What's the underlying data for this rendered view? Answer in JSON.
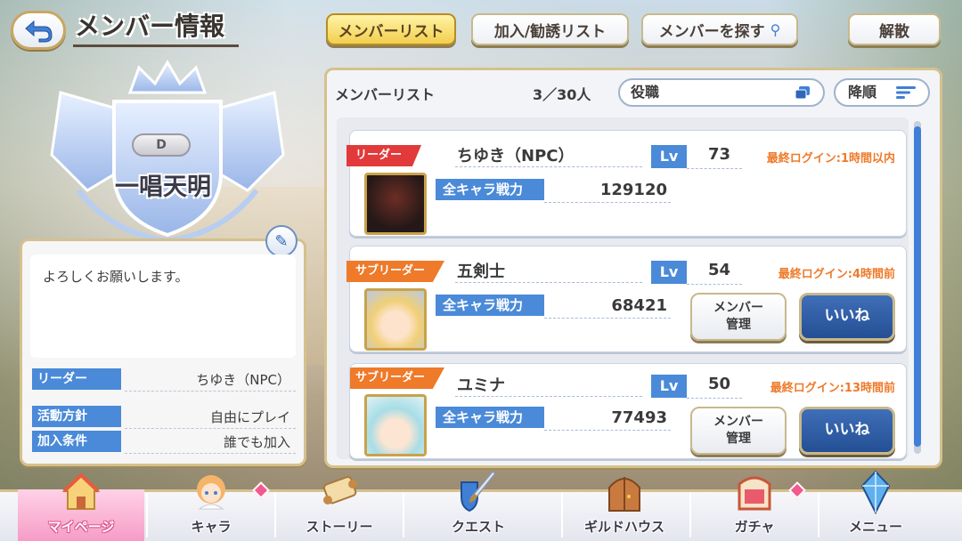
{
  "header": {
    "title": "メンバー情報",
    "tabs": [
      {
        "label": "メンバーリスト",
        "active": true
      },
      {
        "label": "加入/勧誘リスト",
        "active": false
      },
      {
        "label": "メンバーを探す",
        "active": false,
        "icon": "search-icon"
      },
      {
        "label": "解散",
        "active": false
      }
    ]
  },
  "guild": {
    "name": "一唱天明",
    "rank": "D",
    "description": "よろしくお願いします。",
    "info": [
      {
        "key": "リーダー",
        "value": "ちゆき（NPC）"
      },
      {
        "key": "活動方針",
        "value": "自由にプレイ"
      },
      {
        "key": "加入条件",
        "value": "誰でも加入"
      }
    ]
  },
  "member_list": {
    "title": "メンバーリスト",
    "count": "3／30人",
    "sort_key": "役職",
    "sort_order": "降順",
    "power_label": "全キャラ戦力",
    "lv_label": "Lv",
    "members": [
      {
        "role": "リーダー",
        "name": "ちゆき（NPC）",
        "level": "73",
        "power": "129120",
        "last_login": "最終ログイン:1時間以内",
        "manage_label": "",
        "like_label": ""
      },
      {
        "role": "サブリーダー",
        "name": "五剣士",
        "level": "54",
        "power": "68421",
        "last_login": "最終ログイン:4時間前",
        "manage_label": "メンバー\n管理",
        "like_label": "いいね"
      },
      {
        "role": "サブリーダー",
        "name": "ユミナ",
        "level": "50",
        "power": "77493",
        "last_login": "最終ログイン:13時間前",
        "manage_label": "メンバー\n管理",
        "like_label": "いいね"
      }
    ]
  },
  "nav": [
    {
      "label": "マイページ",
      "icon": "home-icon",
      "active": true
    },
    {
      "label": "キャラ",
      "icon": "character-icon",
      "active": false,
      "badge": true
    },
    {
      "label": "ストーリー",
      "icon": "scroll-icon",
      "active": false
    },
    {
      "label": "クエスト",
      "icon": "sword-shield-icon",
      "active": false
    },
    {
      "label": "ギルドハウス",
      "icon": "door-icon",
      "active": false
    },
    {
      "label": "ガチャ",
      "icon": "gacha-icon",
      "active": false,
      "badge": true
    },
    {
      "label": "メニュー",
      "icon": "crystal-icon",
      "active": false
    }
  ],
  "colors": {
    "accent_blue": "#4a8ad8",
    "leader_red": "#e23a3a",
    "subleader_orange": "#ee7a2a",
    "active_tab_yellow": "#f3cf4e",
    "nav_active_pink": "#f59cc7"
  }
}
